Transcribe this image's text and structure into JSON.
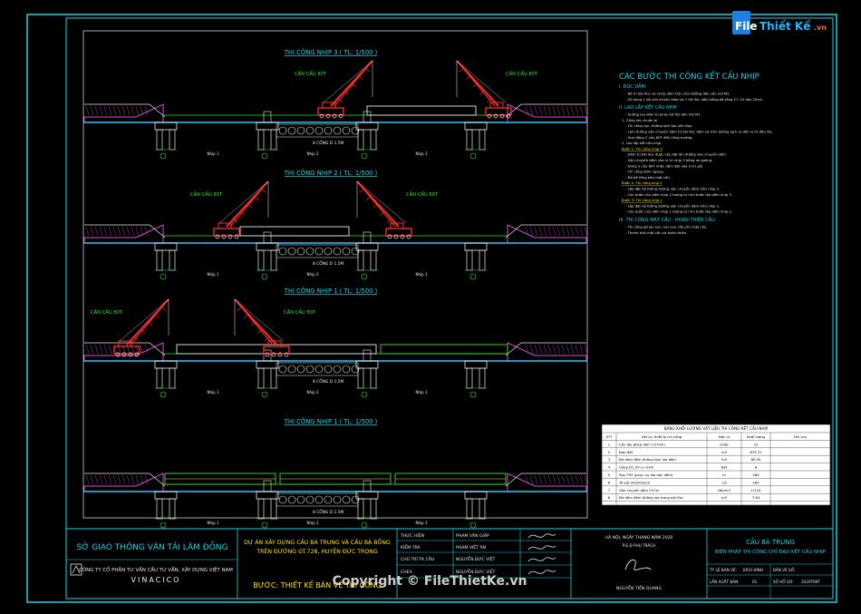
{
  "colors": {
    "frame": "#19d3e6",
    "section_title": "#19d3e6",
    "crane": "#ff2a2a",
    "green": "#2fe32f",
    "yellow": "#ffe600",
    "white": "#e8e8e8",
    "magenta": "#d24dd2",
    "cyan": "#2ac6ff",
    "orange": "#ff8a1f",
    "table_bg": "#ffffff"
  },
  "stages": [
    {
      "title": "THI CÔNG NHỊP 3 ( TL: 1/500 )",
      "crane_label_left": "CẦN CẨU 80T",
      "crane_label_right": "CẦN CẨU 80T",
      "span_labels": [
        "Nhịp 1",
        "Nhịp 2",
        "Nhịp 3"
      ],
      "pipe_label": "8 CỐNG D 1.5M"
    },
    {
      "title": "THI CÔNG NHỊP 2 ( TL: 1/500 )",
      "crane_label_left": "CẦN CẨU 80T",
      "crane_label_right": "CẦN CẨU 80T",
      "span_labels": [
        "Nhịp 1",
        "Nhịp 2",
        "Nhịp 3"
      ],
      "pipe_label": "8 CỐNG D 1.5M"
    },
    {
      "title": "THI CÔNG NHỊP 1 ( TL: 1/500 )",
      "crane_label_left": "CẦN CẨU 80T",
      "crane_label_right": "CẦN CẨU 80T",
      "span_labels": [
        "Nhịp 1",
        "Nhịp 2",
        "Nhịp 3"
      ],
      "pipe_label": "8 CỐNG D 1.5M"
    },
    {
      "title": "THI CÔNG NHỊP 1 ( TL: 1/500 )",
      "crane_label_left": "",
      "crane_label_right": "",
      "span_labels": [
        "Nhịp 1",
        "Nhịp 2",
        "Nhịp 3"
      ],
      "pipe_label": "8 CỐNG D 1.5M"
    }
  ],
  "notes": {
    "heading": "CÁC BƯỚC THI CÔNG KẾT CẤU NHỊP",
    "lines": [
      "I. ĐÚC DẦM:",
      "- Bố trí bãi đúc và chứa dầm trên nền đường đầu cầu mố M2.",
      "- Sử dụng 1 bộ ván khuôn thép và 1 hệ đúc dầm bằng bê tông F.C 25 dày 20cm",
      "II. LAO LẮP KẾT CẤU NHỊP",
      "- Hướng lao dầm từ phía mố M2 đến mố M1.",
      "1. Công tác chuẩn bị",
      "- Thi công cọc, đường lạm tạo nền đạo.",
      "- Làm đường vận chuyển dầm từ bãi đúc dầm và trên đường tạm ra đến vị trí đầu lấy.",
      "- Huy động 2 cẩu 80T đến công trường.",
      "2. Lao lắp kết cấu nhịp",
      "Bước 1: Thi công nhịp 3",
      "- Dầm từ bãi đúc được cẩu đặt lên đường vận chuyển dầm.",
      "- Vận chuyển dầm vào vị trí nhịp 3 bằng xe goòng.",
      "- Dùng 2 cẩu 80T nhấc dầm đặt vào vị trí gối.",
      "- Thi công dầm ngang.",
      "- Đổ bê tông bản mặt cầu.",
      "Bước 2: Thi công nhịp 2",
      "- Lắp đặt hệ thống đường vận chuyển dầm trên nhịp 2.",
      "- Các bước cẩu dầm nhịp 2 tương tự như bước lắp dầm nhịp 3.",
      "Bước 3: Thi công nhịp 1",
      "- Lắp đặt hệ thống đường vận chuyển dầm trên nhịp 1.",
      "- Các bước cẩu dầm nhịp 1 tương tự như bước lắp dầm nhịp 2.",
      "III. THI CÔNG MẶT CẦU - HOÀN THIỆN CẦU",
      "- Thi công gờ lan can, lan can, lớp phủ mặt cầu.",
      "- Thanh thải mặt cầu và hoàn thiện."
    ]
  },
  "table": {
    "title": "BẢNG KHỐI LƯỢNG VẬT LIỆU THI CÔNG KẾT CẤU NHỊP",
    "headers": [
      "STT",
      "Vật tư, thiết bị chi công",
      "Đơn vị",
      "Khối lượng",
      "Ghi chú"
    ],
    "rows": [
      [
        "1",
        "Cẩu lắp ghép dầm C57mm",
        "chiếc",
        "10",
        ""
      ],
      [
        "2",
        "Đáp đất",
        "m3",
        "875.31",
        ""
      ],
      [
        "3",
        "Đá dăm đệm đường tạm lao dầm",
        "m3",
        "80.00",
        ""
      ],
      [
        "4",
        "Cống D1.5m L=1km",
        "Đốt",
        "8",
        ""
      ],
      [
        "5",
        "Ray P43 (phục vụ lao dọc dầm)",
        "m",
        "280",
        ""
      ],
      [
        "6",
        "Tà vẹt 20x20x220",
        "cái",
        "280",
        ""
      ],
      [
        "7",
        "Vận chuyển dầm C57m",
        "tấn/m3",
        "1/120",
        ""
      ],
      [
        "8",
        "Đá dăm đệm đường lao trong bãi đúc",
        "m3",
        "7.64",
        ""
      ]
    ]
  },
  "titleblock": {
    "org": "SỞ GIAO THÔNG VẬN TẢI LÂM ĐỒNG",
    "company": "CÔNG TY CỔ PHẦN TƯ VẤN CẦU TƯ VẤN, XÂY DỰNG VIỆT NAM",
    "company_short": "VINACICO",
    "project": "DỰ ÁN XÂY DỰNG CẦU BÀ TRUNG VÀ CẦU BÀ BỐNG",
    "project_line2": "TRÊN ĐƯỜNG GT.728, HUYỆN ĐỨC TRỌNG",
    "stage": "BƯỚC: THIẾT KẾ BẢN VẼ THI CÔNG",
    "roles": [
      "THỰC HIỆN",
      "KIỂM TRA",
      "CHỦ TRÌ TK CẦU",
      "CHEA"
    ],
    "names": [
      "PHẠM VĂN GIÁP",
      "PHẠM VIẾT ÁN",
      "NGUYỄN ĐỨC VIỆT",
      "NGUYỄN ĐỨC VIỆT"
    ],
    "date": "HÀ NỘI, NGÀY    THÁNG    NĂM 2020",
    "director_role": "P.G.Đ PHỤ TRÁCH",
    "director": "NGUYỄN TIẾN QUANG",
    "bridge": "CẦU BÀ TRUNG",
    "drawing": "BIỆN PHÁP THI CÔNG CHỈ ĐẠO KẾT CẤU NHỊP",
    "meta": [
      "TỶ LỆ BẢN VẼ:",
      "KÍCH HÌNH",
      "BẢN VẼ SỐ:",
      "LẦN XUẤT BẢN:",
      "01",
      "SỐ HỒ SƠ:",
      "2020TKKT"
    ]
  },
  "logo": {
    "text_a": "File",
    "text_b": "Thiết Kế",
    ".vn": ".vn",
    "suffix": ".vn"
  },
  "watermark": "Copyright © FileThietKe.vn"
}
